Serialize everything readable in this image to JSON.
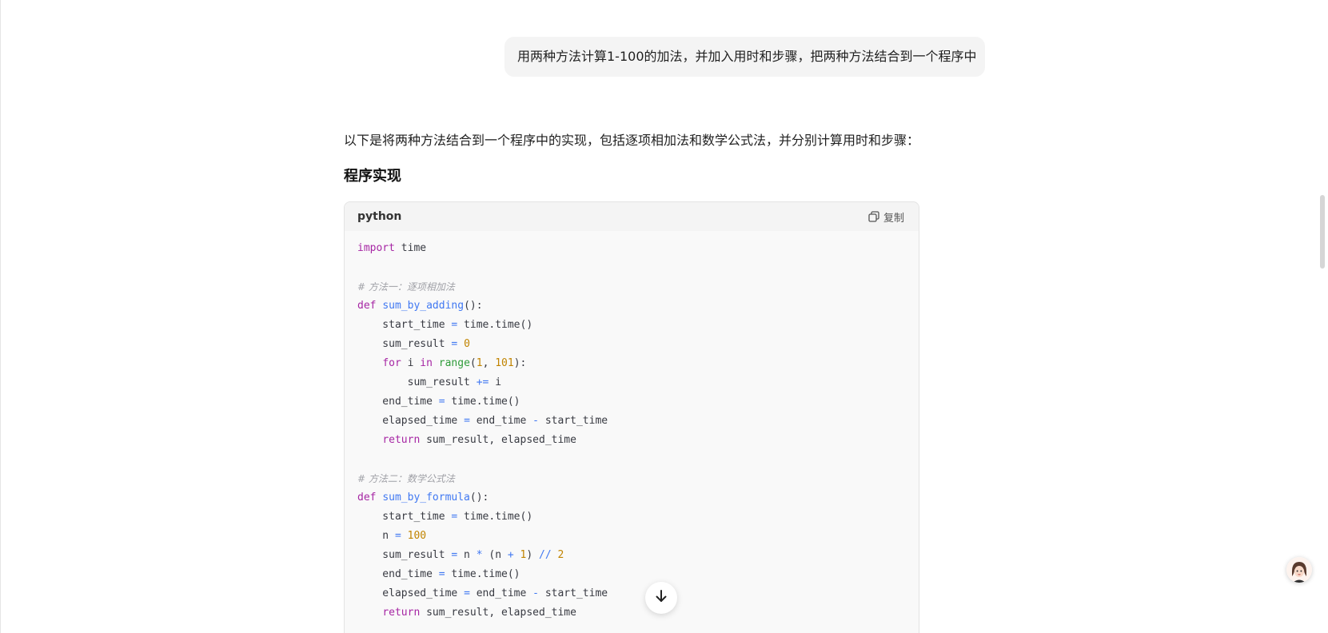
{
  "conversation": {
    "user_message": "用两种方法计算1-100的加法，并加入用时和步骤，把两种方法结合到一个程序中",
    "answer_intro": "以下是将两种方法结合到一个程序中的实现，包括逐项相加法和数学公式法，并分别计算用时和步骤：",
    "section_heading": "程序实现"
  },
  "code_block": {
    "language": "python",
    "copy_label": "复制",
    "lines": [
      [
        {
          "t": "import",
          "c": "kw"
        },
        {
          "t": " time"
        }
      ],
      [],
      [
        {
          "t": "# 方法一：逐项相加法",
          "c": "cm"
        }
      ],
      [
        {
          "t": "def",
          "c": "kw"
        },
        {
          "t": " "
        },
        {
          "t": "sum_by_adding",
          "c": "fn"
        },
        {
          "t": "():"
        }
      ],
      [
        {
          "t": "    start_time "
        },
        {
          "t": "=",
          "c": "op"
        },
        {
          "t": " time.time()"
        }
      ],
      [
        {
          "t": "    sum_result "
        },
        {
          "t": "=",
          "c": "op"
        },
        {
          "t": " "
        },
        {
          "t": "0",
          "c": "num"
        }
      ],
      [
        {
          "t": "    "
        },
        {
          "t": "for",
          "c": "kw"
        },
        {
          "t": " i "
        },
        {
          "t": "in",
          "c": "kw"
        },
        {
          "t": " "
        },
        {
          "t": "range",
          "c": "bi"
        },
        {
          "t": "("
        },
        {
          "t": "1",
          "c": "num"
        },
        {
          "t": ", "
        },
        {
          "t": "101",
          "c": "num"
        },
        {
          "t": "):"
        }
      ],
      [
        {
          "t": "        sum_result "
        },
        {
          "t": "+=",
          "c": "op"
        },
        {
          "t": " i"
        }
      ],
      [
        {
          "t": "    end_time "
        },
        {
          "t": "=",
          "c": "op"
        },
        {
          "t": " time.time()"
        }
      ],
      [
        {
          "t": "    elapsed_time "
        },
        {
          "t": "=",
          "c": "op"
        },
        {
          "t": " end_time "
        },
        {
          "t": "-",
          "c": "op"
        },
        {
          "t": " start_time"
        }
      ],
      [
        {
          "t": "    "
        },
        {
          "t": "return",
          "c": "kw"
        },
        {
          "t": " sum_result, elapsed_time"
        }
      ],
      [],
      [
        {
          "t": "# 方法二：数学公式法",
          "c": "cm"
        }
      ],
      [
        {
          "t": "def",
          "c": "kw"
        },
        {
          "t": " "
        },
        {
          "t": "sum_by_formula",
          "c": "fn"
        },
        {
          "t": "():"
        }
      ],
      [
        {
          "t": "    start_time "
        },
        {
          "t": "=",
          "c": "op"
        },
        {
          "t": " time.time()"
        }
      ],
      [
        {
          "t": "    n "
        },
        {
          "t": "=",
          "c": "op"
        },
        {
          "t": " "
        },
        {
          "t": "100",
          "c": "num"
        }
      ],
      [
        {
          "t": "    sum_result "
        },
        {
          "t": "=",
          "c": "op"
        },
        {
          "t": " n "
        },
        {
          "t": "*",
          "c": "op"
        },
        {
          "t": " (n "
        },
        {
          "t": "+",
          "c": "op"
        },
        {
          "t": " "
        },
        {
          "t": "1",
          "c": "num"
        },
        {
          "t": ") "
        },
        {
          "t": "//",
          "c": "op"
        },
        {
          "t": " "
        },
        {
          "t": "2",
          "c": "num"
        }
      ],
      [
        {
          "t": "    end_time "
        },
        {
          "t": "=",
          "c": "op"
        },
        {
          "t": " time.time()"
        }
      ],
      [
        {
          "t": "    elapsed_time "
        },
        {
          "t": "=",
          "c": "op"
        },
        {
          "t": " end_time "
        },
        {
          "t": "-",
          "c": "op"
        },
        {
          "t": " start_time"
        }
      ],
      [
        {
          "t": "    "
        },
        {
          "t": "return",
          "c": "kw"
        },
        {
          "t": " sum_result, elapsed_time"
        }
      ]
    ]
  },
  "icons": {
    "copy": "copy-icon",
    "scroll_down": "arrow-down-icon",
    "assistant": "assistant-avatar-icon"
  },
  "colors": {
    "keyword": "#a626a4",
    "function": "#4078f2",
    "number": "#c18401",
    "builtin": "#2f9c3a",
    "comment": "#a0a1a7"
  }
}
